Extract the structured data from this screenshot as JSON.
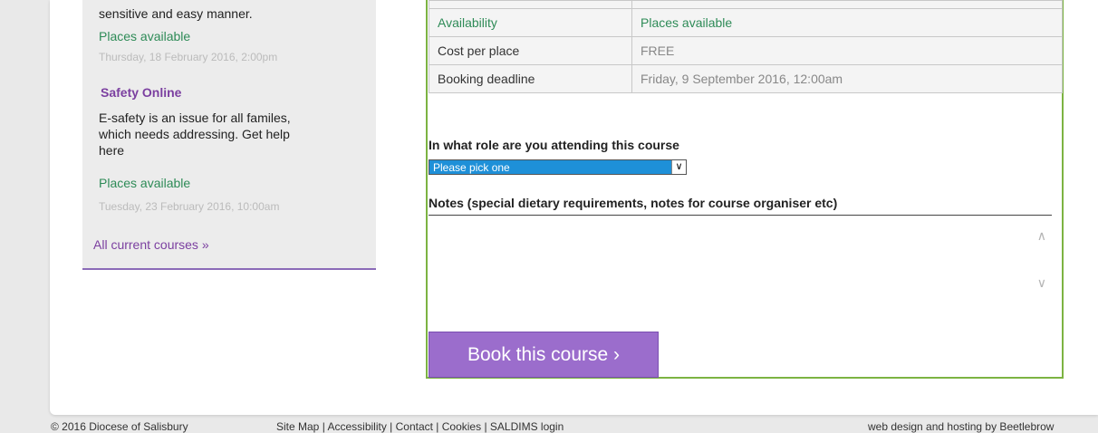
{
  "sidebar": {
    "course1": {
      "desc_tail": "sensitive and easy manner.",
      "availability": "Places available",
      "date": "Thursday, 18 February 2016, 2:00pm"
    },
    "course2": {
      "title": "Safety Online",
      "desc_line1": "E-safety is an issue for all familes,",
      "desc_line2": "which needs addressing. Get help",
      "desc_line3": "here",
      "availability": "Places available",
      "date": "Tuesday, 23 February 2016, 10:00am"
    },
    "all_courses_link": "All current courses »"
  },
  "details": {
    "availability_label": "Availability",
    "availability_value": "Places available",
    "cost_label": "Cost per place",
    "cost_value": "FREE",
    "deadline_label": "Booking deadline",
    "deadline_value": "Friday, 9 September 2016, 12:00am"
  },
  "form": {
    "role_label": "In what role are you attending this course",
    "role_selected": "Please pick one",
    "notes_label": "Notes (special dietary requirements, notes for course organiser etc)",
    "book_button": "Book this course ›"
  },
  "footer": {
    "copyright": "© 2016 Diocese of Salisbury",
    "links": "Site Map | Accessibility | Contact | Cookies | SALDIMS login",
    "credit": "web design and hosting by Beetlebrow"
  },
  "colors": {
    "accent_purple": "#9b6dcc",
    "available_green": "#2e8b57",
    "box_border_green": "#7cb342"
  }
}
